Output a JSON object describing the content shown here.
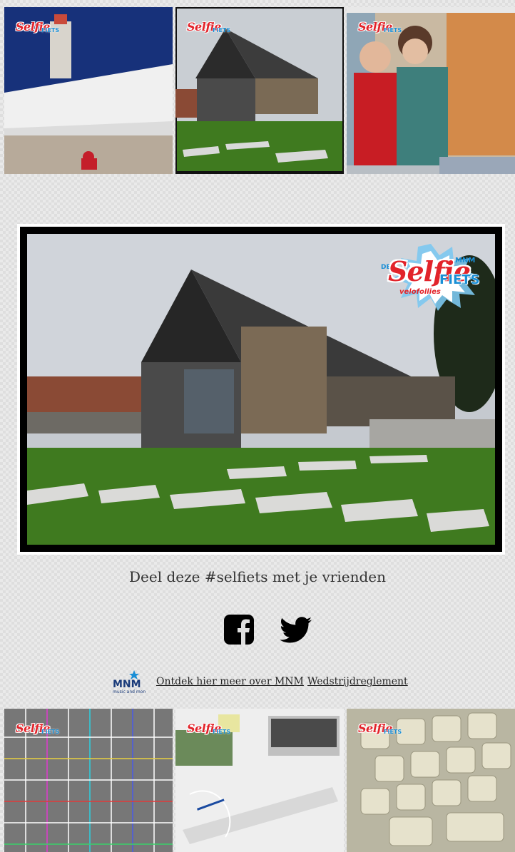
{
  "share": {
    "text": "Deel deze #selfiets met je vrienden"
  },
  "badge": {
    "selfie": "Selfie",
    "fiets": "FIETS",
    "velofollies": "velofollies",
    "de": "DE",
    "mnm": "MNM"
  },
  "footer": {
    "logo_text": "MNM",
    "logo_sub": "music and more",
    "link_mnm": "Ontdek hier meer over MNM",
    "link_rules": "Wedstrijdreglement"
  },
  "icons": {
    "facebook": "facebook-icon",
    "twitter": "twitter-icon"
  },
  "colors": {
    "badge_red": "#e2232a",
    "badge_blue": "#1a8fd6",
    "text": "#333333"
  }
}
